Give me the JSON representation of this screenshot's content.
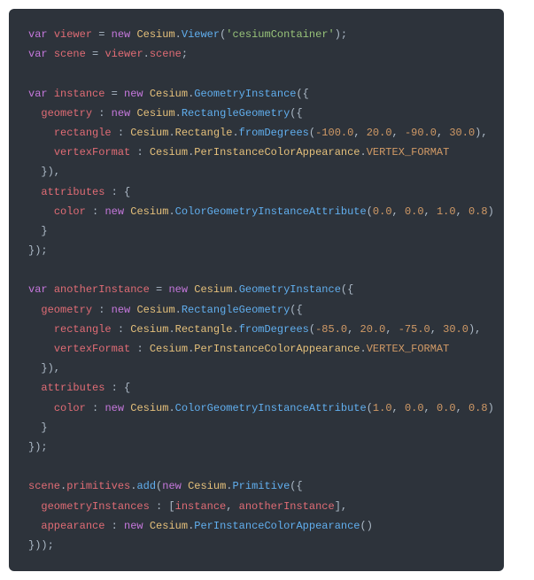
{
  "code": {
    "kw_var": "var",
    "kw_new": "new",
    "id_viewer": "viewer",
    "id_scene": "scene",
    "id_instance": "instance",
    "id_anotherInstance": "anotherInstance",
    "cls_Cesium": "Cesium",
    "cls_Viewer": "Viewer",
    "cls_GeometryInstance": "GeometryInstance",
    "cls_RectangleGeometry": "RectangleGeometry",
    "cls_Rectangle": "Rectangle",
    "cls_PerInstanceColorAppearance": "PerInstanceColorAppearance",
    "cls_ColorGeometryInstanceAttribute": "ColorGeometryInstanceAttribute",
    "cls_Primitive": "Primitive",
    "prop_scene": "scene",
    "prop_geometry": "geometry",
    "prop_rectangle": "rectangle",
    "prop_vertexFormat": "vertexFormat",
    "prop_attributes": "attributes",
    "prop_color": "color",
    "prop_primitives": "primitives",
    "prop_geometryInstances": "geometryInstances",
    "prop_appearance": "appearance",
    "fn_fromDegrees": "fromDegrees",
    "fn_add": "add",
    "const_VERTEX_FORMAT": "VERTEX_FORMAT",
    "str_container": "'cesiumContainer'",
    "n_m100": "-100.0",
    "n_20": "20.0",
    "n_m90": "-90.0",
    "n_30": "30.0",
    "n_0": "0.0",
    "n_1": "1.0",
    "n_08": "0.8",
    "n_m85": "-85.0",
    "n_m75": "-75.0"
  }
}
